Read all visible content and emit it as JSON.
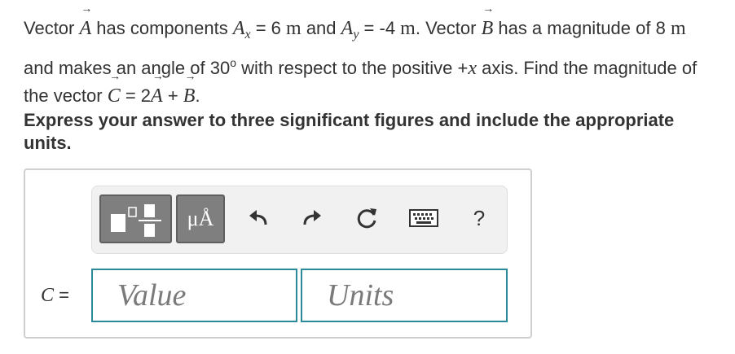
{
  "problem": {
    "t1": "Vector ",
    "vecA": "A",
    "t2": " has components ",
    "Ax_sym": "A",
    "x_sub": "x",
    "t3": " = 6 ",
    "unit_m1": "m",
    "t4": " and ",
    "Ay_sym": "A",
    "y_sub": "y",
    "t5": " = -4 ",
    "unit_m2": "m",
    "t6": ". Vector ",
    "vecB1": "B",
    "t7": " has a magnitude of 8 ",
    "unit_m3": "m",
    "t8": " and makes an angle of 30",
    "deg": "o",
    "t9": " with respect to the positive +",
    "xaxis": "x",
    "t10": " axis. Find the magnitude of the vector ",
    "vecC": "C",
    "t11": " = 2",
    "vecA2": "A",
    "t12": " + ",
    "vecB2": "B",
    "t13": "."
  },
  "instruction": "Express your answer to three significant figures and include the appropriate units.",
  "toolbar": {
    "units_button": "μÅ",
    "help": "?"
  },
  "answer": {
    "var": "C",
    "equals": " =",
    "value_placeholder": "Value",
    "value": "",
    "units_placeholder": "Units",
    "units": ""
  }
}
